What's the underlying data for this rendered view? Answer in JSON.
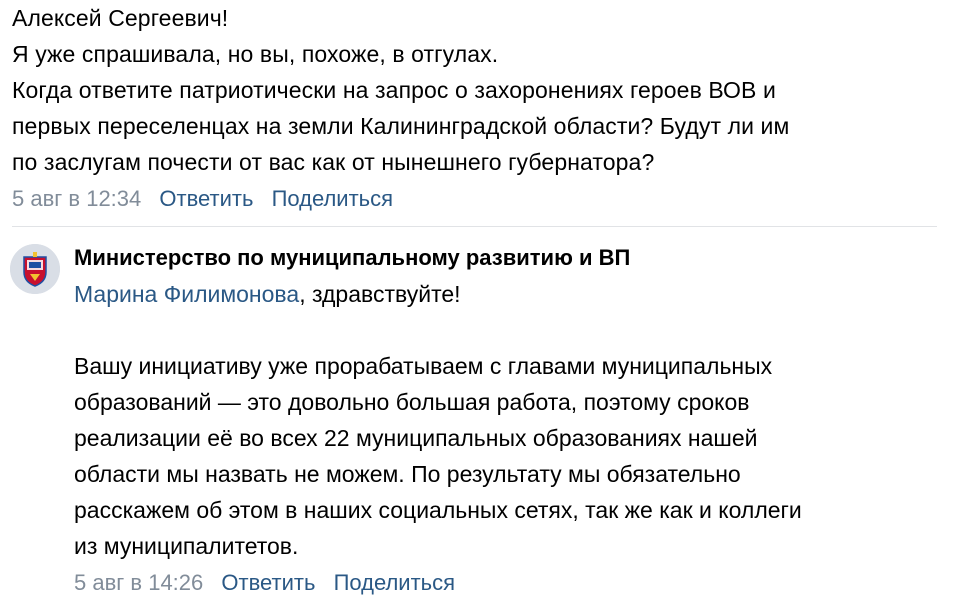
{
  "comment1": {
    "lines": [
      "Алексей Сергеевич!",
      "Я уже спрашивала, но вы, похоже, в отгулах.",
      "Когда ответите патриотически на запрос о захоронениях героев ВОВ и",
      "первых переселенцах на земли Калининградской области? Будут ли им",
      "по заслугам почести от вас как от нынешнего губернатора?"
    ],
    "date": "5 авг в 12:34",
    "reply_label": "Ответить",
    "share_label": "Поделиться"
  },
  "reply": {
    "author": "Министерство по муниципальному развитию и ВП",
    "mention": "Марина Филимонова",
    "greeting_rest": ", здравствуйте!",
    "lines": [
      "Вашу инициативу уже прорабатываем с главами муниципальных",
      "образований — это довольно большая работа, поэтому сроков",
      "реализации её во всех 22 муниципальных образованиях нашей",
      "области мы назвать не можем. По результату мы обязательно",
      "расскажем об этом в наших социальных сетях, так же как и коллеги",
      "из муниципалитетов."
    ],
    "date": "5 авг в 14:26",
    "reply_label": "Ответить",
    "share_label": "Поделиться"
  },
  "colors": {
    "link": "#2a5885",
    "meta": "#818c99",
    "divider": "#e1e3e6",
    "avatar_shield": "#c8102e",
    "avatar_blue": "#1f4fa3"
  },
  "icons": {
    "avatar": "kaliningrad-region-coat-of-arms-icon"
  }
}
